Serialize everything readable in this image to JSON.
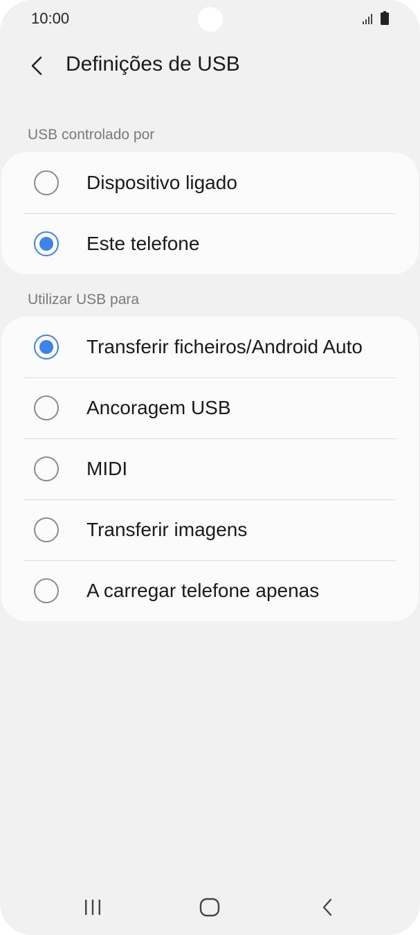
{
  "status_bar": {
    "time": "10:00",
    "icons": [
      "signal-icon",
      "battery-icon"
    ]
  },
  "header": {
    "title": "Definições de USB",
    "back_icon": "chevron-left-icon"
  },
  "sections": [
    {
      "label": "USB controlado por",
      "options": [
        {
          "label": "Dispositivo ligado",
          "selected": false
        },
        {
          "label": "Este telefone",
          "selected": true
        }
      ]
    },
    {
      "label": "Utilizar USB para",
      "options": [
        {
          "label": "Transferir ficheiros/Android Auto",
          "selected": true
        },
        {
          "label": "Ancoragem USB",
          "selected": false
        },
        {
          "label": "MIDI",
          "selected": false
        },
        {
          "label": "Transferir imagens",
          "selected": false
        },
        {
          "label": "A carregar telefone apenas",
          "selected": false
        }
      ]
    }
  ],
  "nav_bar": {
    "icons": [
      "recent-apps-icon",
      "home-icon",
      "back-icon"
    ]
  },
  "colors": {
    "accent": "#3e83e8",
    "background": "#f1f1f1",
    "card": "#fbfbfb"
  }
}
